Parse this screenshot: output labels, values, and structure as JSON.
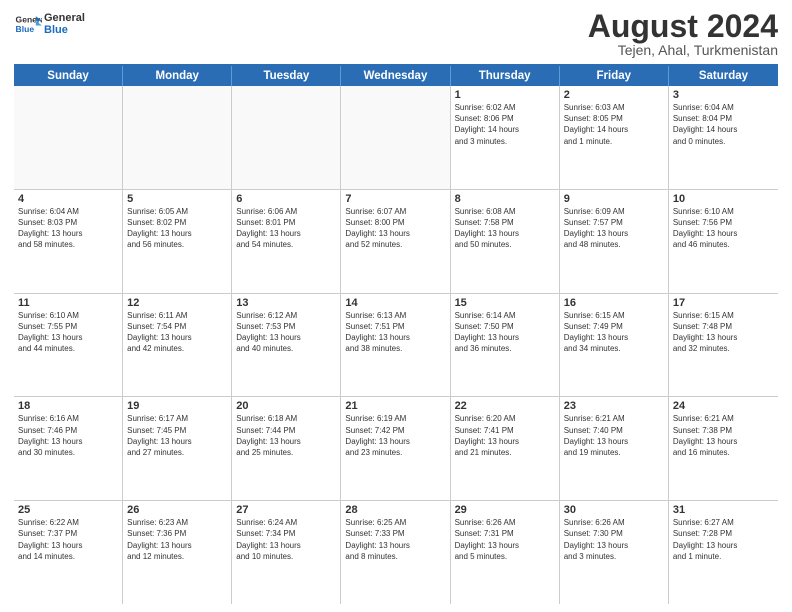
{
  "logo": {
    "line1": "General",
    "line2": "Blue"
  },
  "header": {
    "month": "August 2024",
    "location": "Tejen, Ahal, Turkmenistan"
  },
  "weekdays": [
    "Sunday",
    "Monday",
    "Tuesday",
    "Wednesday",
    "Thursday",
    "Friday",
    "Saturday"
  ],
  "rows": [
    [
      {
        "day": "",
        "text": ""
      },
      {
        "day": "",
        "text": ""
      },
      {
        "day": "",
        "text": ""
      },
      {
        "day": "",
        "text": ""
      },
      {
        "day": "1",
        "text": "Sunrise: 6:02 AM\nSunset: 8:06 PM\nDaylight: 14 hours\nand 3 minutes."
      },
      {
        "day": "2",
        "text": "Sunrise: 6:03 AM\nSunset: 8:05 PM\nDaylight: 14 hours\nand 1 minute."
      },
      {
        "day": "3",
        "text": "Sunrise: 6:04 AM\nSunset: 8:04 PM\nDaylight: 14 hours\nand 0 minutes."
      }
    ],
    [
      {
        "day": "4",
        "text": "Sunrise: 6:04 AM\nSunset: 8:03 PM\nDaylight: 13 hours\nand 58 minutes."
      },
      {
        "day": "5",
        "text": "Sunrise: 6:05 AM\nSunset: 8:02 PM\nDaylight: 13 hours\nand 56 minutes."
      },
      {
        "day": "6",
        "text": "Sunrise: 6:06 AM\nSunset: 8:01 PM\nDaylight: 13 hours\nand 54 minutes."
      },
      {
        "day": "7",
        "text": "Sunrise: 6:07 AM\nSunset: 8:00 PM\nDaylight: 13 hours\nand 52 minutes."
      },
      {
        "day": "8",
        "text": "Sunrise: 6:08 AM\nSunset: 7:58 PM\nDaylight: 13 hours\nand 50 minutes."
      },
      {
        "day": "9",
        "text": "Sunrise: 6:09 AM\nSunset: 7:57 PM\nDaylight: 13 hours\nand 48 minutes."
      },
      {
        "day": "10",
        "text": "Sunrise: 6:10 AM\nSunset: 7:56 PM\nDaylight: 13 hours\nand 46 minutes."
      }
    ],
    [
      {
        "day": "11",
        "text": "Sunrise: 6:10 AM\nSunset: 7:55 PM\nDaylight: 13 hours\nand 44 minutes."
      },
      {
        "day": "12",
        "text": "Sunrise: 6:11 AM\nSunset: 7:54 PM\nDaylight: 13 hours\nand 42 minutes."
      },
      {
        "day": "13",
        "text": "Sunrise: 6:12 AM\nSunset: 7:53 PM\nDaylight: 13 hours\nand 40 minutes."
      },
      {
        "day": "14",
        "text": "Sunrise: 6:13 AM\nSunset: 7:51 PM\nDaylight: 13 hours\nand 38 minutes."
      },
      {
        "day": "15",
        "text": "Sunrise: 6:14 AM\nSunset: 7:50 PM\nDaylight: 13 hours\nand 36 minutes."
      },
      {
        "day": "16",
        "text": "Sunrise: 6:15 AM\nSunset: 7:49 PM\nDaylight: 13 hours\nand 34 minutes."
      },
      {
        "day": "17",
        "text": "Sunrise: 6:15 AM\nSunset: 7:48 PM\nDaylight: 13 hours\nand 32 minutes."
      }
    ],
    [
      {
        "day": "18",
        "text": "Sunrise: 6:16 AM\nSunset: 7:46 PM\nDaylight: 13 hours\nand 30 minutes."
      },
      {
        "day": "19",
        "text": "Sunrise: 6:17 AM\nSunset: 7:45 PM\nDaylight: 13 hours\nand 27 minutes."
      },
      {
        "day": "20",
        "text": "Sunrise: 6:18 AM\nSunset: 7:44 PM\nDaylight: 13 hours\nand 25 minutes."
      },
      {
        "day": "21",
        "text": "Sunrise: 6:19 AM\nSunset: 7:42 PM\nDaylight: 13 hours\nand 23 minutes."
      },
      {
        "day": "22",
        "text": "Sunrise: 6:20 AM\nSunset: 7:41 PM\nDaylight: 13 hours\nand 21 minutes."
      },
      {
        "day": "23",
        "text": "Sunrise: 6:21 AM\nSunset: 7:40 PM\nDaylight: 13 hours\nand 19 minutes."
      },
      {
        "day": "24",
        "text": "Sunrise: 6:21 AM\nSunset: 7:38 PM\nDaylight: 13 hours\nand 16 minutes."
      }
    ],
    [
      {
        "day": "25",
        "text": "Sunrise: 6:22 AM\nSunset: 7:37 PM\nDaylight: 13 hours\nand 14 minutes."
      },
      {
        "day": "26",
        "text": "Sunrise: 6:23 AM\nSunset: 7:36 PM\nDaylight: 13 hours\nand 12 minutes."
      },
      {
        "day": "27",
        "text": "Sunrise: 6:24 AM\nSunset: 7:34 PM\nDaylight: 13 hours\nand 10 minutes."
      },
      {
        "day": "28",
        "text": "Sunrise: 6:25 AM\nSunset: 7:33 PM\nDaylight: 13 hours\nand 8 minutes."
      },
      {
        "day": "29",
        "text": "Sunrise: 6:26 AM\nSunset: 7:31 PM\nDaylight: 13 hours\nand 5 minutes."
      },
      {
        "day": "30",
        "text": "Sunrise: 6:26 AM\nSunset: 7:30 PM\nDaylight: 13 hours\nand 3 minutes."
      },
      {
        "day": "31",
        "text": "Sunrise: 6:27 AM\nSunset: 7:28 PM\nDaylight: 13 hours\nand 1 minute."
      }
    ]
  ]
}
